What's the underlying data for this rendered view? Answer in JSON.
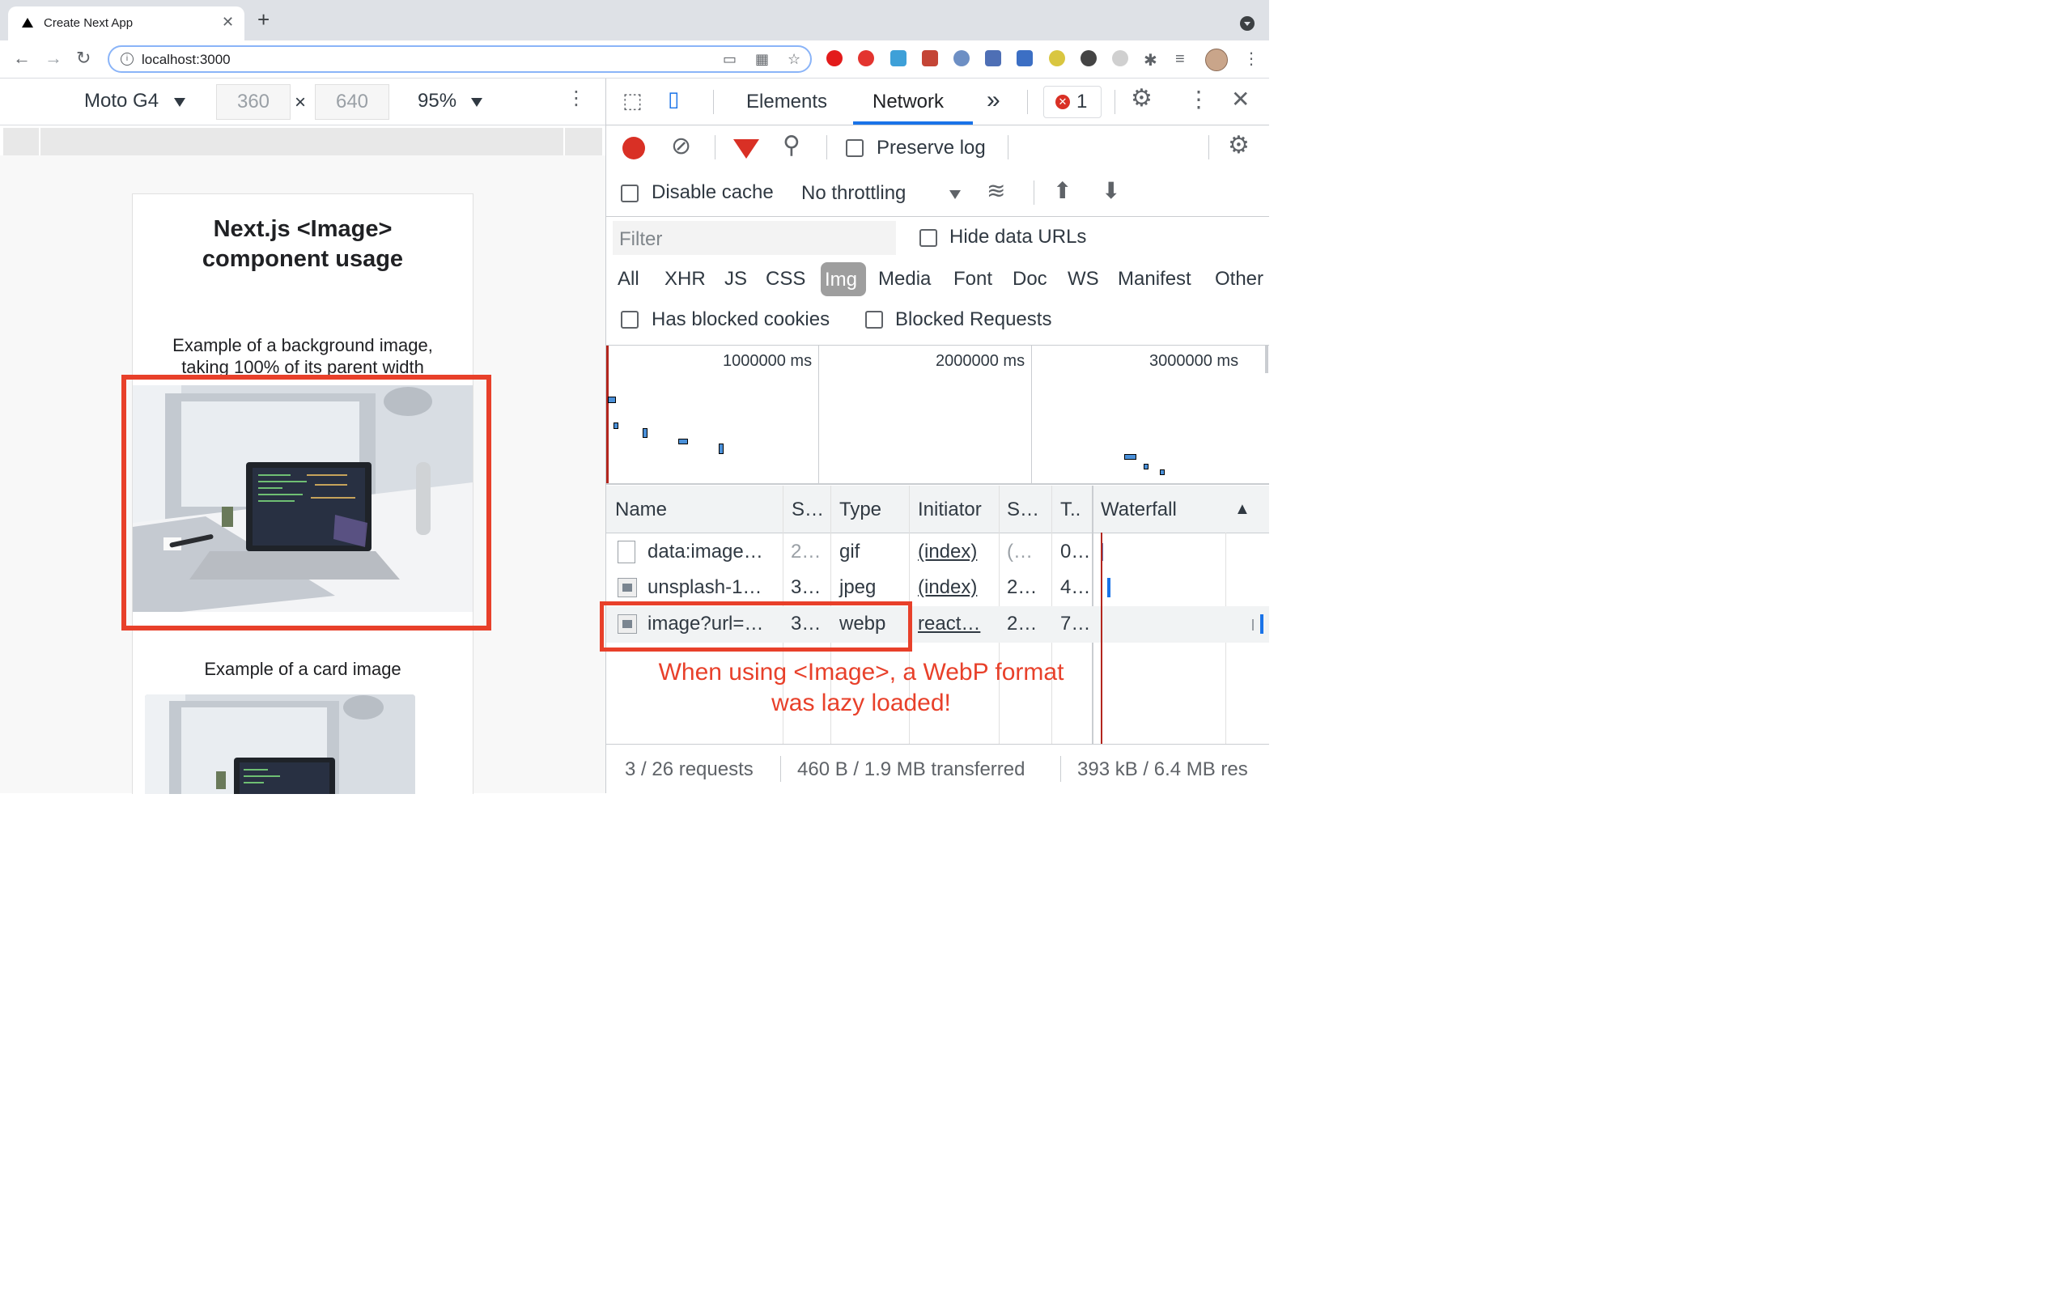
{
  "browser": {
    "tab_title": "Create Next App",
    "tab_close": "✕",
    "new_tab": "+",
    "url": "localhost:3000",
    "icons": [
      "back-arrow-icon",
      "forward-arrow-icon",
      "reload-icon",
      "info-icon",
      "cast-icon",
      "qr-icon",
      "star-icon",
      "extensions-icon",
      "menu-icon"
    ]
  },
  "device_toolbar": {
    "device": "Moto G4",
    "width": "360",
    "height": "640",
    "times": "×",
    "zoom": "95%"
  },
  "page": {
    "title_line1": "Next.js <Image>",
    "title_line2": "component usage",
    "bg_caption_line1": "Example of a background image,",
    "bg_caption_line2": "taking 100% of its parent width",
    "card_caption": "Example of a card image"
  },
  "devtools": {
    "tabs": {
      "elements": "Elements",
      "network": "Network",
      "more": "»",
      "error_count": "1"
    },
    "toolbar": {
      "preserve_log": "Preserve log",
      "disable_cache": "Disable cache",
      "throttling": "No throttling"
    },
    "filter": {
      "placeholder": "Filter",
      "hide_data_urls": "Hide data URLs",
      "types": [
        "All",
        "XHR",
        "JS",
        "CSS",
        "Img",
        "Media",
        "Font",
        "Doc",
        "WS",
        "Manifest",
        "Other"
      ],
      "active_type": "Img",
      "has_blocked_cookies": "Has blocked cookies",
      "blocked_requests": "Blocked Requests"
    },
    "timeline": {
      "ticks": [
        "1000000 ms",
        "2000000 ms",
        "3000000 ms"
      ]
    },
    "table": {
      "headers": {
        "name": "Name",
        "status": "S…",
        "type": "Type",
        "initiator": "Initiator",
        "size": "S…",
        "time": "T..",
        "waterfall": "Waterfall",
        "sort": "▲"
      },
      "rows": [
        {
          "name": "data:image…",
          "status": "2…",
          "type": "gif",
          "initiator": "(index)",
          "size": "(…",
          "time": "0…"
        },
        {
          "name": "unsplash-1…",
          "status": "3…",
          "type": "jpeg",
          "initiator": "(index)",
          "size": "2…",
          "time": "4…"
        },
        {
          "name": "image?url=…",
          "status": "3…",
          "type": "webp",
          "initiator": "react…",
          "size": "2…",
          "time": "7…"
        }
      ]
    },
    "annotation_line1": "When using <Image>, a WebP format",
    "annotation_line2": "was lazy loaded!",
    "status": {
      "requests": "3 / 26 requests",
      "transferred": "460 B / 1.9 MB transferred",
      "resources": "393 kB / 6.4 MB res"
    }
  },
  "colors": {
    "annotation_red": "#e8402a",
    "network_tab_underline": "#1a73e8",
    "record_red": "#d93025",
    "img_filter_bg": "#9e9e9e"
  }
}
